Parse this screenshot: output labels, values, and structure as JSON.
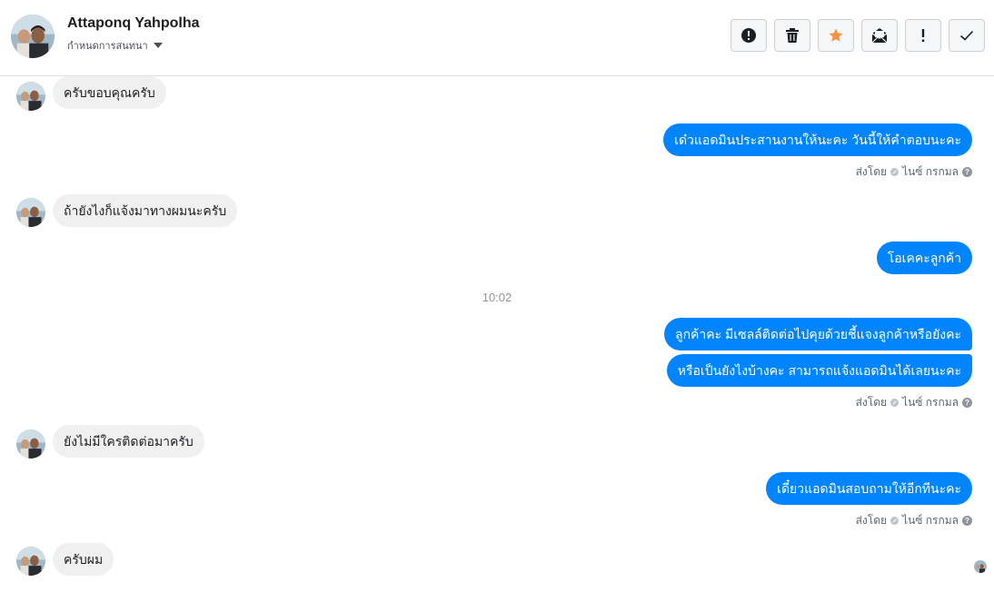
{
  "header": {
    "contact_name": "Attaponq Yahpolha",
    "label_select": "กำหนดการสนทนา",
    "toolbar": [
      {
        "icon": "alert-circle-icon",
        "name": "mark-spam-button"
      },
      {
        "icon": "trash-icon",
        "name": "delete-button"
      },
      {
        "icon": "star-icon",
        "name": "star-button"
      },
      {
        "icon": "mark-unread-icon",
        "name": "mark-unread-button"
      },
      {
        "icon": "exclamation-icon",
        "name": "follow-up-button"
      },
      {
        "icon": "check-icon",
        "name": "mark-done-button"
      }
    ]
  },
  "colors": {
    "accent_blue": "#0084ff",
    "incoming_bubble": "#f1f0f0",
    "star_orange": "#f7923b"
  },
  "thread": {
    "time_separator": "10:02",
    "sent_by_label": "ส่งโดย",
    "sender_name": "ไนซ์ กรกมล",
    "messages": [
      {
        "direction": "in",
        "text": "ครับขอบคุณครับ"
      },
      {
        "direction": "out",
        "text": "เด๋วแอดมินประสานงานให้นะคะ วันนี้ให้คำตอบนะคะ"
      },
      {
        "direction": "in",
        "text": "ถ้ายังไงก็แจ้งมาทางผมนะครับ"
      },
      {
        "direction": "out",
        "text": "โอเคคะลูกค้า"
      },
      {
        "direction": "out",
        "text": "ลูกค้าคะ มีเซลล์ติดต่อไปคุยด้วยชี้แจงลูกค้าหรือยังคะ"
      },
      {
        "direction": "out",
        "text": "หรือเป็นยังไงบ้างคะ สามารถแจ้งแอดมินได้เลยนะคะ"
      },
      {
        "direction": "in",
        "text": "ยังไม่มีใครติดต่อมาครับ"
      },
      {
        "direction": "out",
        "text": "เดี๋ยวแอดมินสอบถามให้อีกทีนะคะ"
      },
      {
        "direction": "in",
        "text": "ครับผม"
      }
    ]
  }
}
